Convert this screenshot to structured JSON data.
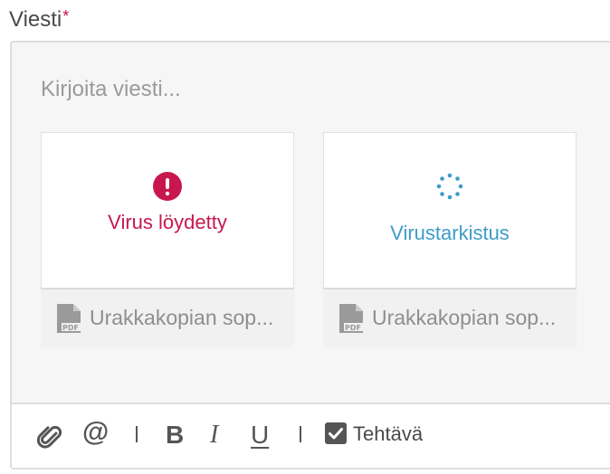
{
  "field": {
    "label": "Viesti",
    "required_mark": "*"
  },
  "editor": {
    "placeholder": "Kirjoita viesti..."
  },
  "attachments": [
    {
      "status": "Virus löydetty",
      "status_type": "error",
      "file_name": "Urakkakopian sop...",
      "file_type": "PDF"
    },
    {
      "status": "Virustarkistus",
      "status_type": "scanning",
      "file_name": "Urakkakopian sop...",
      "file_type": "PDF"
    }
  ],
  "toolbar": {
    "attach_icon": "paperclip-icon",
    "mention_label": "@",
    "bold_label": "B",
    "italic_label": "I",
    "underline_label": "U",
    "task_label": "Tehtävä",
    "task_checked": true
  },
  "colors": {
    "error": "#c8174e",
    "scanning": "#3d9cc8",
    "required": "#d0104c"
  }
}
